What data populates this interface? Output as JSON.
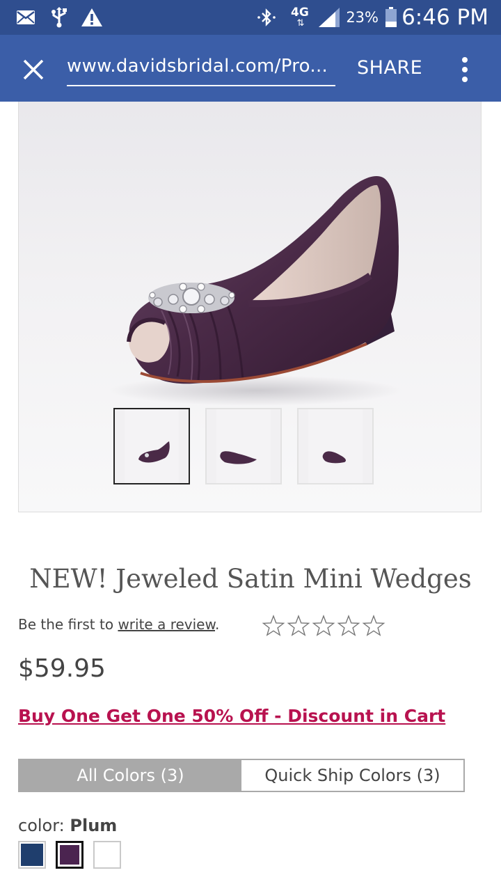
{
  "status_bar": {
    "network": "4G",
    "battery": "23%",
    "time": "6:46 PM"
  },
  "browser": {
    "url": "www.davidsbridal.com/Pro...",
    "share_label": "SHARE"
  },
  "product": {
    "title": "NEW! Jeweled Satin Mini Wedges",
    "review_prefix": "Be the first to ",
    "review_link": "write a review",
    "review_suffix": ".",
    "rating": 0,
    "price": "$59.95",
    "promo": "Buy One Get One 50% Off - Discount in Cart",
    "thumbnails": [
      "front view",
      "side view",
      "back view"
    ],
    "selected_thumbnail": 0
  },
  "colors": {
    "tabs": [
      {
        "label": "All Colors (3)",
        "active": true
      },
      {
        "label": "Quick Ship Colors (3)",
        "active": false
      }
    ],
    "label_prefix": "color: ",
    "selected_name": "Plum",
    "swatches": [
      {
        "name": "Navy",
        "hex": "#1f3e6d"
      },
      {
        "name": "Plum",
        "hex": "#4b2450"
      },
      {
        "name": "Ivory",
        "hex": "#ffffff"
      }
    ],
    "selected_index": 1
  },
  "theme": {
    "status_bar_bg": "#2f4e8f",
    "toolbar_bg": "#3b5ea8",
    "promo_color": "#b8124f",
    "shoe_color": "#4a2a47"
  }
}
